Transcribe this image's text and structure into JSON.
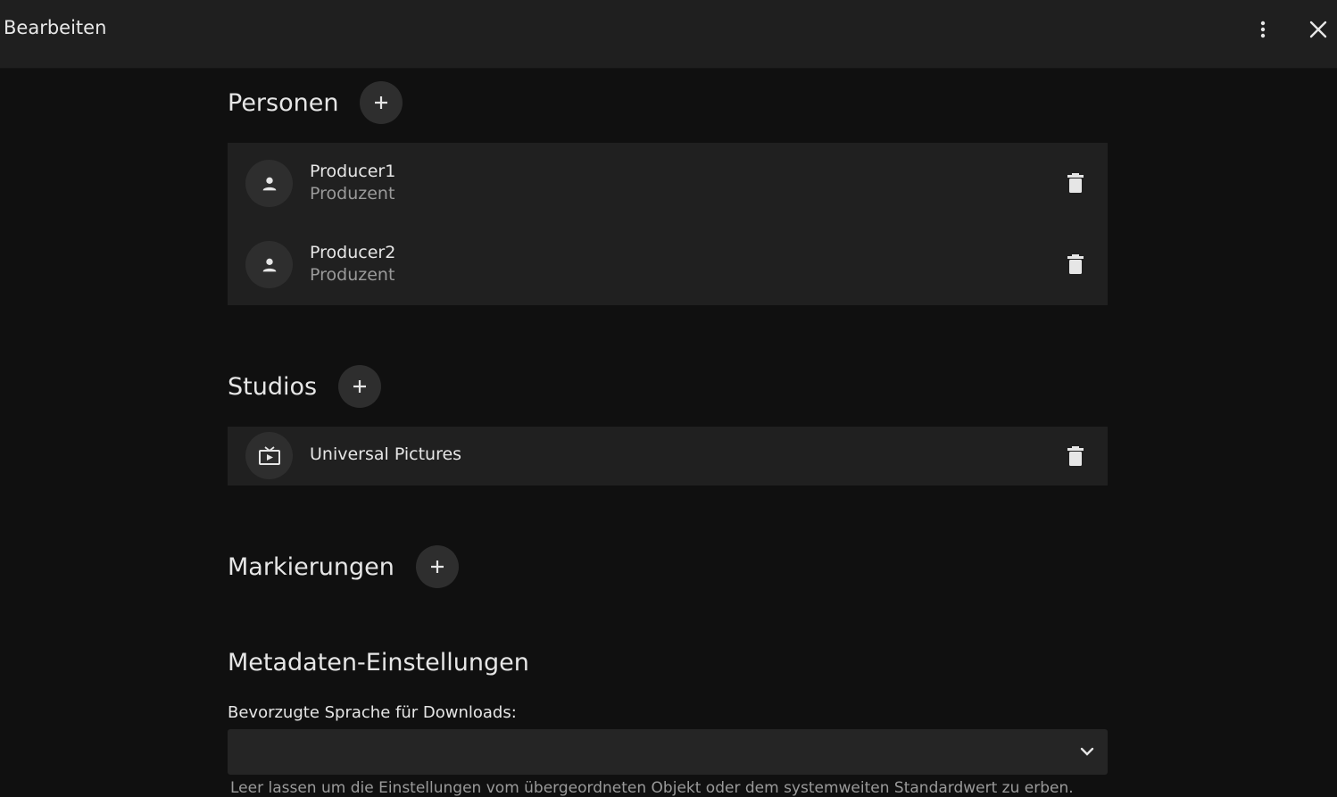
{
  "header": {
    "title": "Bearbeiten"
  },
  "persons": {
    "heading": "Personen",
    "items": [
      {
        "name": "Producer1",
        "role": "Produzent"
      },
      {
        "name": "Producer2",
        "role": "Produzent"
      }
    ]
  },
  "studios": {
    "heading": "Studios",
    "items": [
      {
        "name": "Universal Pictures"
      }
    ]
  },
  "tags": {
    "heading": "Markierungen"
  },
  "metadata": {
    "heading": "Metadaten-Einstellungen",
    "language_label": "Bevorzugte Sprache für Downloads:",
    "language_value": "",
    "helper_text": "Leer lassen um die Einstellungen vom übergeordneten Objekt oder dem systemweiten Standardwert zu erben."
  },
  "icons": {
    "kebab": "more-vert-icon",
    "close": "close-icon",
    "add": "plus-icon",
    "person": "person-icon",
    "studio": "tv-icon",
    "delete": "trash-icon",
    "dropdown": "chevron-down-icon"
  }
}
